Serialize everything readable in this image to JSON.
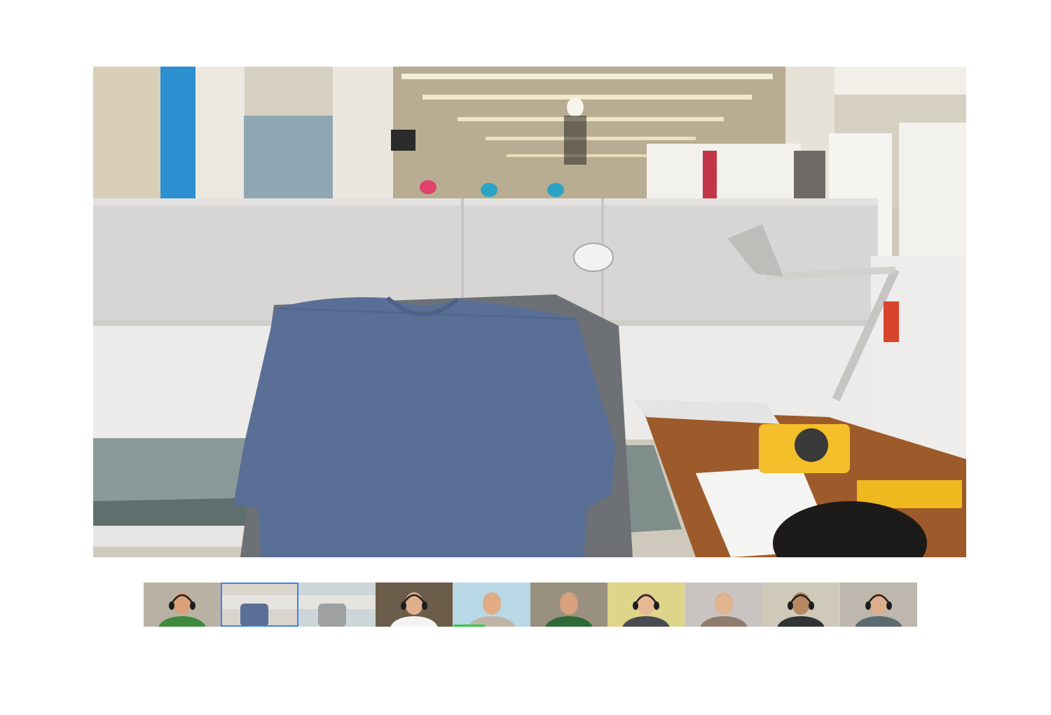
{
  "main_video": {
    "participant": "self-view",
    "scene": "office-cubicle-with-tshirt-on-chair"
  },
  "filmstrip": {
    "participants": [
      {
        "shirt_color": "#3f8a3c",
        "background": "#b9b2a4",
        "skin": "#d9a07a",
        "hair": "#8a6a3c",
        "headphones": true,
        "selected": false,
        "speaking": false
      },
      {
        "shirt_color": "#5a6f95",
        "background": "#d9d5cc",
        "skin": "none",
        "hair": "none",
        "headphones": false,
        "selected": true,
        "speaking": false
      },
      {
        "shirt_color": "#9fa0a2",
        "background": "#cdd6d8",
        "skin": "none",
        "hair": "none",
        "headphones": false,
        "selected": false,
        "speaking": false
      },
      {
        "shirt_color": "#f3f3f3",
        "background": "#6b5d49",
        "skin": "#e0b08c",
        "hair": "#3a2a1e",
        "headphones": true,
        "selected": false,
        "speaking": false
      },
      {
        "shirt_color": "#c0b4a4",
        "background": "#b9d8e6",
        "skin": "#e1ac84",
        "hair": "#6a4a2c",
        "headphones": false,
        "selected": false,
        "speaking": true
      },
      {
        "shirt_color": "#2d6a35",
        "background": "#9a9080",
        "skin": "#d8a27e",
        "hair": "#5b4428",
        "headphones": false,
        "selected": false,
        "speaking": false
      },
      {
        "shirt_color": "#4a4a52",
        "background": "#dcd58a",
        "skin": "#e6b894",
        "hair": "#a6844e",
        "headphones": true,
        "selected": false,
        "speaking": false
      },
      {
        "shirt_color": "#8e7d6d",
        "background": "#c9c3c2",
        "skin": "#e0b48e",
        "hair": "#1e1a18",
        "headphones": false,
        "selected": false,
        "speaking": false
      },
      {
        "shirt_color": "#2f3436",
        "background": "#cfc9b9",
        "skin": "#b68862",
        "hair": "#1b1612",
        "headphones": true,
        "selected": false,
        "speaking": false
      },
      {
        "shirt_color": "#5a6a70",
        "background": "#bdb7ad",
        "skin": "#dcae8c",
        "hair": "#b49264",
        "headphones": true,
        "selected": false,
        "speaking": false
      }
    ]
  },
  "colors": {
    "selected_border": "#3b82f0",
    "speaking_indicator": "#2ecc40"
  }
}
